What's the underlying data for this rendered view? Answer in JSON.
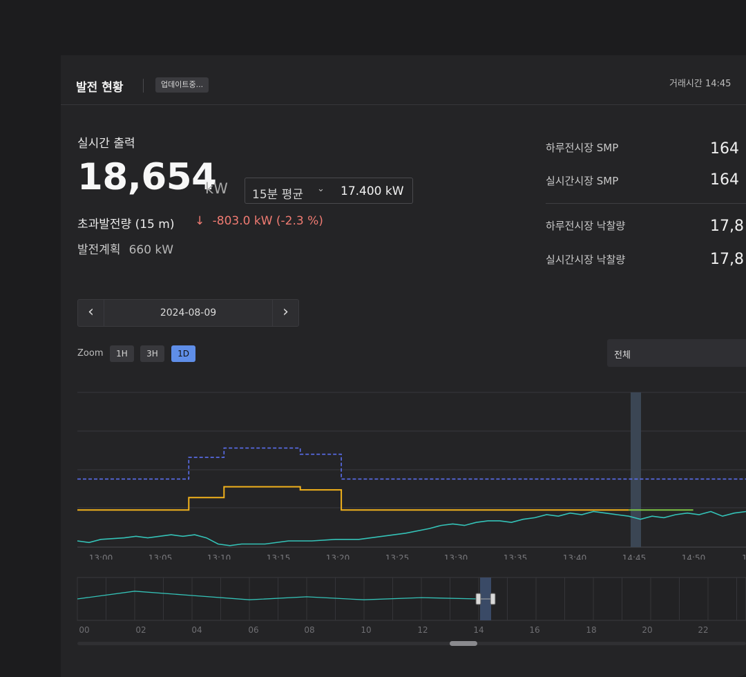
{
  "header": {
    "title": "발전 현황",
    "badge": "업데이트중...",
    "trade_time": "거래시간 14:45"
  },
  "realtime": {
    "label": "실시간 출력",
    "value": "18,654",
    "unit": "kW",
    "avg_select": "15분 평균",
    "avg_value": "17.400 kW",
    "excess_label": "초과발전량 (15 m)",
    "excess_arrow": "↓",
    "excess_value": "-803.0 kW (-2.3 %)",
    "plan_label": "발전계획",
    "plan_value": "660 kW"
  },
  "markets": [
    {
      "label": "하루전시장 SMP",
      "value": "164"
    },
    {
      "label": "실시간시장 SMP",
      "value": "164"
    },
    {
      "label": "하루전시장 낙찰량",
      "value": "17,8"
    },
    {
      "label": "실시간시장 낙찰량",
      "value": "17,8"
    }
  ],
  "date_nav": {
    "date": "2024-08-09",
    "prev": "‹",
    "next": "›"
  },
  "zoom": {
    "label": "Zoom",
    "options": [
      "1H",
      "3H",
      "1D"
    ],
    "active": "1D"
  },
  "filter": {
    "selected": "전체"
  },
  "colors": {
    "plan_dashed": "#5b6ff0",
    "bid_step": "#f2b21c",
    "forecast": "#7dc544",
    "output": "#34c3b8",
    "cursor_band": "#3b4654"
  },
  "chart_data": {
    "type": "line",
    "x_ticks": [
      "13:00",
      "13:05",
      "13:10",
      "13:15",
      "13:20",
      "13:25",
      "13:30",
      "13:35",
      "13:40",
      "14:45",
      "14:50",
      "1"
    ],
    "cursor_at": "14:45",
    "series": [
      {
        "key": "plan_dashed",
        "style": "dashed-step",
        "segments": [
          [
            0,
            0.44
          ],
          [
            9.5,
            0.44
          ],
          [
            9.5,
            0.58
          ],
          [
            12.5,
            0.58
          ],
          [
            12.5,
            0.64
          ],
          [
            19,
            0.64
          ],
          [
            19,
            0.6
          ],
          [
            22.5,
            0.6
          ],
          [
            22.5,
            0.44
          ],
          [
            57,
            0.44
          ]
        ]
      },
      {
        "key": "bid_step",
        "style": "step",
        "segments": [
          [
            0,
            0.24
          ],
          [
            9.5,
            0.24
          ],
          [
            9.5,
            0.32
          ],
          [
            12.5,
            0.32
          ],
          [
            12.5,
            0.39
          ],
          [
            19,
            0.39
          ],
          [
            19,
            0.37
          ],
          [
            22.5,
            0.37
          ],
          [
            22.5,
            0.24
          ],
          [
            47,
            0.24
          ]
        ]
      },
      {
        "key": "forecast",
        "style": "line",
        "segments": [
          [
            47,
            0.24
          ],
          [
            52.5,
            0.24
          ]
        ]
      },
      {
        "key": "output",
        "style": "line",
        "points": [
          [
            0,
            0.04
          ],
          [
            1,
            0.03
          ],
          [
            2,
            0.05
          ],
          [
            4,
            0.06
          ],
          [
            5,
            0.07
          ],
          [
            6,
            0.06
          ],
          [
            7,
            0.07
          ],
          [
            8,
            0.08
          ],
          [
            9,
            0.07
          ],
          [
            10,
            0.08
          ],
          [
            11,
            0.06
          ],
          [
            12,
            0.02
          ],
          [
            13,
            0.01
          ],
          [
            14,
            0.02
          ],
          [
            16,
            0.02
          ],
          [
            18,
            0.04
          ],
          [
            20,
            0.04
          ],
          [
            22,
            0.05
          ],
          [
            24,
            0.05
          ],
          [
            26,
            0.07
          ],
          [
            28,
            0.09
          ],
          [
            30,
            0.12
          ],
          [
            31,
            0.14
          ],
          [
            32,
            0.15
          ],
          [
            33,
            0.14
          ],
          [
            34,
            0.16
          ],
          [
            35,
            0.17
          ],
          [
            36,
            0.17
          ],
          [
            37,
            0.16
          ],
          [
            38,
            0.18
          ],
          [
            39,
            0.19
          ],
          [
            40,
            0.21
          ],
          [
            41,
            0.2
          ],
          [
            42,
            0.22
          ],
          [
            43,
            0.21
          ],
          [
            44,
            0.23
          ],
          [
            45,
            0.22
          ],
          [
            46,
            0.21
          ],
          [
            47,
            0.2
          ],
          [
            48,
            0.18
          ],
          [
            49,
            0.2
          ],
          [
            50,
            0.19
          ],
          [
            51,
            0.21
          ],
          [
            52,
            0.22
          ],
          [
            53,
            0.21
          ],
          [
            54,
            0.23
          ],
          [
            55,
            0.2
          ],
          [
            56,
            0.22
          ],
          [
            57,
            0.23
          ]
        ]
      }
    ]
  },
  "navigator": {
    "x_ticks": [
      "00",
      "02",
      "04",
      "06",
      "08",
      "10",
      "12",
      "14",
      "16",
      "18",
      "20",
      "22"
    ],
    "points": [
      [
        0,
        0.5
      ],
      [
        2,
        0.68
      ],
      [
        4,
        0.58
      ],
      [
        6,
        0.48
      ],
      [
        8,
        0.55
      ],
      [
        10,
        0.48
      ],
      [
        12,
        0.53
      ],
      [
        14.0,
        0.5
      ]
    ]
  }
}
